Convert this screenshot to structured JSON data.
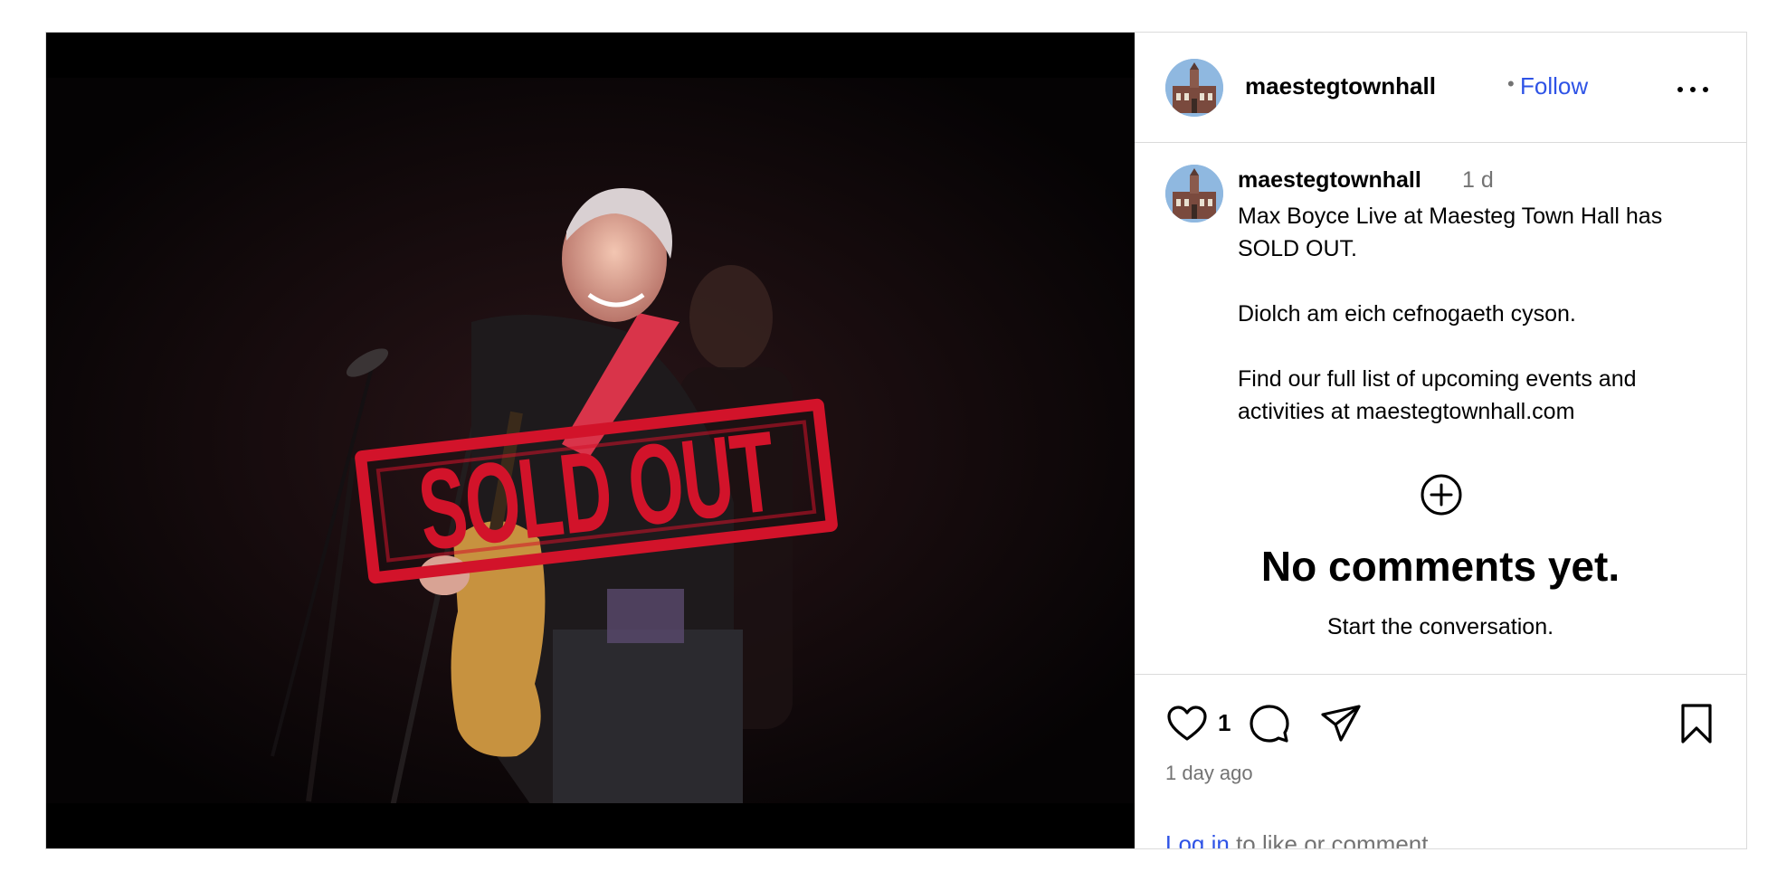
{
  "media": {
    "stamp_text": "SOLD OUT",
    "stamp_color": "#d2132a"
  },
  "header": {
    "username": "maestegtownhall",
    "separator": "•",
    "follow_label": "Follow",
    "more_icon": "more-horizontal-icon"
  },
  "caption": {
    "username": "maestegtownhall",
    "time": "1 d",
    "text": "Max Boyce Live at Maesteg Town Hall has SOLD OUT.\n\nDiolch am eich cefnogaeth cyson.\n\nFind our full list of upcoming events and activities at maestegtownhall.com"
  },
  "comments": {
    "add_icon": "plus-circle-icon",
    "empty_title": "No comments yet.",
    "empty_subtitle": "Start the conversation."
  },
  "actions": {
    "like_count": "1",
    "timestamp": "1 day ago",
    "login_link": "Log in",
    "login_suffix": " to like or comment."
  },
  "colors": {
    "link_blue": "#2e53e6",
    "muted": "#737373",
    "border": "#dbdbdb"
  }
}
